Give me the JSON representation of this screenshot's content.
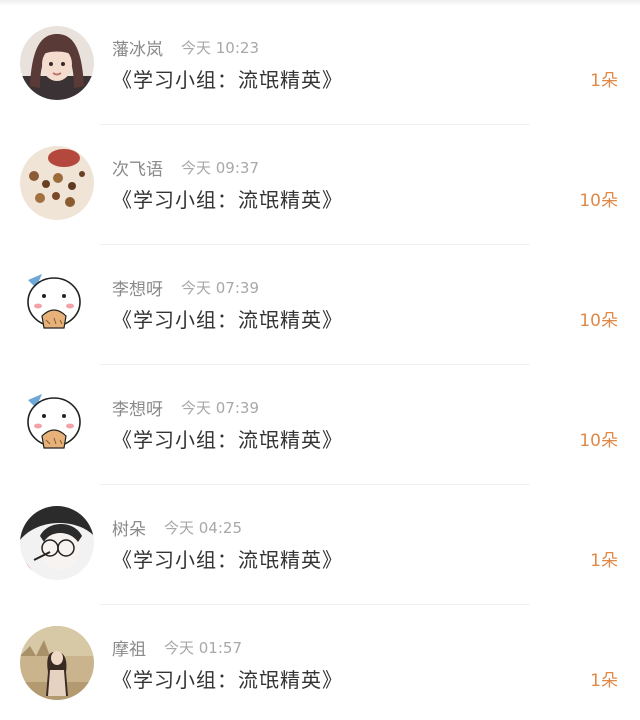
{
  "items": [
    {
      "name": "藩冰岚",
      "time": "今天 10:23",
      "message": "《学习小组：流氓精英》",
      "count": "1朵",
      "avatar": "girl-portrait-avatar"
    },
    {
      "name": "次飞语",
      "time": "今天 09:37",
      "message": "《学习小组：流氓精英》",
      "count": "10朵",
      "avatar": "cookies-photo-avatar"
    },
    {
      "name": "李想呀",
      "time": "今天 07:39",
      "message": "《学习小组：流氓精英》",
      "count": "10朵",
      "avatar": "cartoon-bird-avatar"
    },
    {
      "name": "李想呀",
      "time": "今天 07:39",
      "message": "《学习小组：流氓精英》",
      "count": "10朵",
      "avatar": "cartoon-bird-avatar"
    },
    {
      "name": "树朵",
      "time": "今天 04:25",
      "message": "《学习小组：流氓精英》",
      "count": "1朵",
      "avatar": "anime-boy-avatar"
    },
    {
      "name": "摩祖",
      "time": "今天 01:57",
      "message": "《学习小组：流氓精英》",
      "count": "1朵",
      "avatar": "girl-outdoor-avatar"
    }
  ],
  "colors": {
    "count": "#e08a4a",
    "name": "#8a8a8a",
    "time": "#a8a8a8",
    "message": "#333333"
  }
}
